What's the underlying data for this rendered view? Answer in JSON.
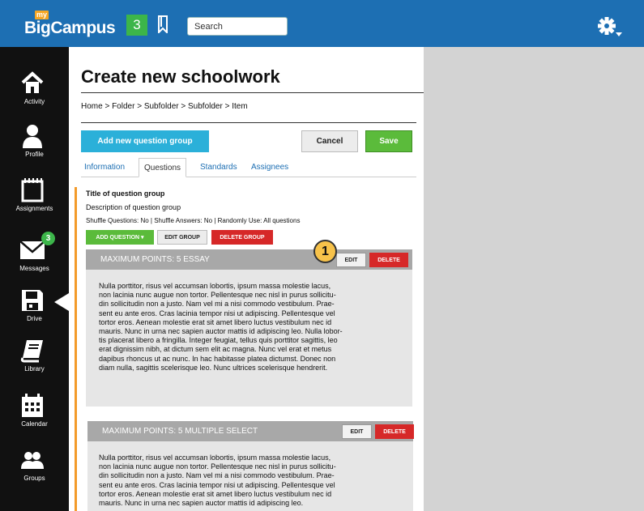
{
  "header": {
    "logo_small": "my",
    "logo_main": "BigCampus",
    "count_badge": "3",
    "search_placeholder": "Search",
    "bg_color": "#1d6fb3"
  },
  "nav": {
    "items": [
      {
        "label": "Activity",
        "icon": "home-icon"
      },
      {
        "label": "Profile",
        "icon": "person-icon"
      },
      {
        "label": "Assignments",
        "icon": "notepad-icon"
      },
      {
        "label": "Messages",
        "icon": "envelope-icon",
        "badge": "3"
      },
      {
        "label": "Drive",
        "icon": "floppy-disk-icon"
      },
      {
        "label": "Library",
        "icon": "book-icon"
      },
      {
        "label": "Calendar",
        "icon": "calendar-icon"
      },
      {
        "label": "Groups",
        "icon": "people-icon"
      }
    ]
  },
  "page": {
    "title": "Create new schoolwork",
    "breadcrumb": "Home > Folder > Subfolder > Subfolder > Item",
    "add_group_label": "Add new question group",
    "cancel_label": "Cancel",
    "save_label": "Save"
  },
  "tabs": [
    "Information",
    "Questions",
    "Standards",
    "Assignees"
  ],
  "group": {
    "title": "Title of question group",
    "description": "Description of question group",
    "meta": "Shuffle Questions: No | Shuffle Answers: No | Randomly Use: All questions",
    "add_question_label": "ADD QUESTION",
    "edit_group_label": "EDIT GROUP",
    "delete_group_label": "DELETE GROUP"
  },
  "questions": [
    {
      "header": "MAXIMUM POINTS: 5 ESSAY",
      "edit_label": "EDIT",
      "delete_label": "DELETE",
      "body_lines": [
        "Nulla porttitor, risus vel accumsan lobortis, ipsum massa molestie lacus,",
        "non lacinia nunc augue non tortor. Pellentesque nec nisl in purus sollicitu-",
        "din sollicitudin non a justo. Nam vel mi a nisi commodo vestibulum. Prae-",
        "sent eu ante eros. Cras lacinia tempor nisi ut adipiscing. Pellentesque vel",
        "tortor eros. Aenean molestie erat sit amet libero luctus vestibulum nec id",
        "mauris. Nunc in urna nec sapien auctor mattis id adipiscing leo. Nulla lobor-",
        "tis placerat libero a fringilla. Integer feugiat, tellus quis porttitor sagittis, leo",
        "erat dignissim nibh, at dictum sem elit ac magna. Nunc vel erat et metus",
        "dapibus rhoncus ut ac nunc. In hac habitasse platea dictumst. Donec non",
        "diam nulla, sagittis scelerisque leo. Nunc ultrices scelerisque hendrerit."
      ]
    },
    {
      "header": "MAXIMUM POINTS: 5 MULTIPLE SELECT",
      "edit_label": "EDIT",
      "delete_label": "DELETE",
      "body_lines": [
        "Nulla porttitor, risus vel accumsan lobortis, ipsum massa molestie lacus,",
        "non lacinia nunc augue non tortor. Pellentesque nec nisl in purus sollicitu-",
        "din sollicitudin non a justo. Nam vel mi a nisi commodo vestibulum. Prae-",
        "sent eu ante eros. Cras lacinia tempor nisi ut adipiscing. Pellentesque vel",
        "tortor eros. Aenean molestie erat sit amet libero luctus vestibulum nec id",
        "mauris. Nunc in urna nec sapien auctor mattis id adipiscing leo."
      ]
    }
  ],
  "callout": "1"
}
